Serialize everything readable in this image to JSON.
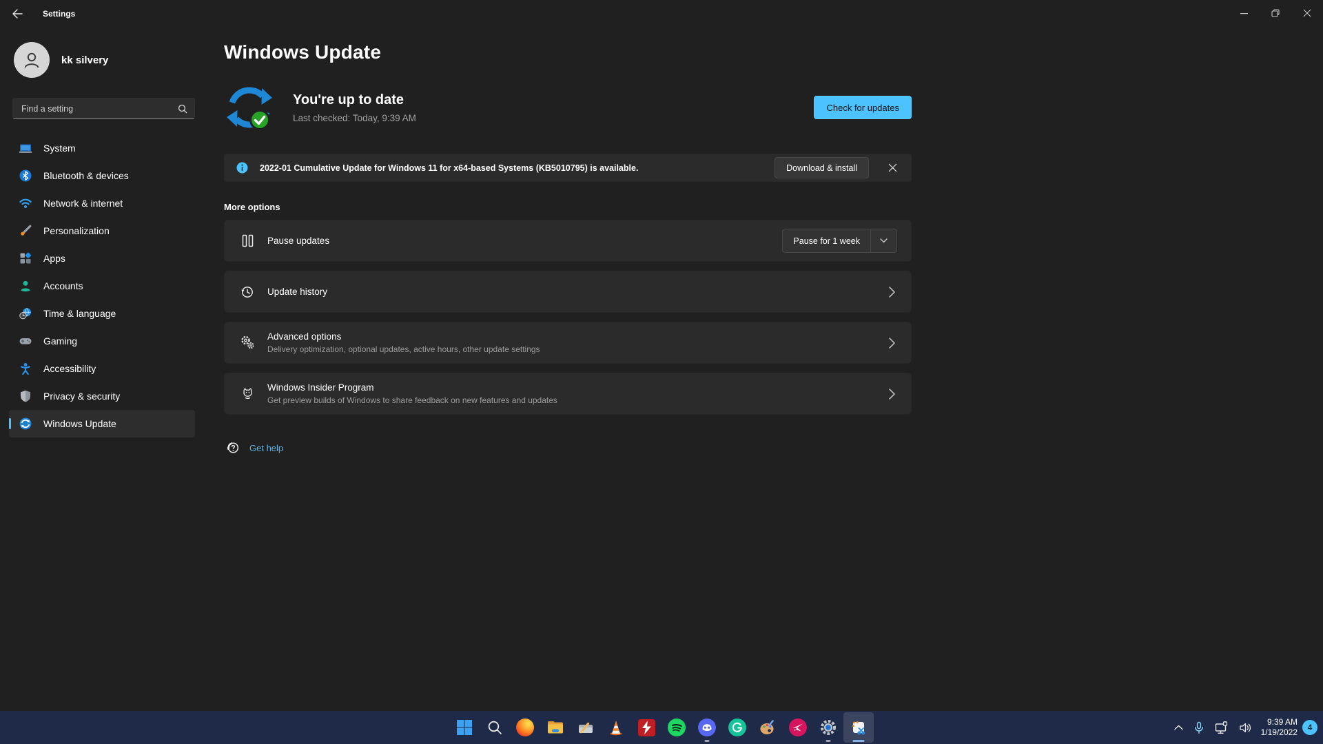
{
  "window": {
    "title": "Settings"
  },
  "sidebar": {
    "user_name": "kk silvery",
    "search_placeholder": "Find a setting",
    "items": [
      {
        "label": "System",
        "icon": "system-icon",
        "selected": false
      },
      {
        "label": "Bluetooth & devices",
        "icon": "bluetooth-icon",
        "selected": false
      },
      {
        "label": "Network & internet",
        "icon": "wifi-icon",
        "selected": false
      },
      {
        "label": "Personalization",
        "icon": "brush-icon",
        "selected": false
      },
      {
        "label": "Apps",
        "icon": "apps-icon",
        "selected": false
      },
      {
        "label": "Accounts",
        "icon": "person-icon",
        "selected": false
      },
      {
        "label": "Time & language",
        "icon": "clock-globe-icon",
        "selected": false
      },
      {
        "label": "Gaming",
        "icon": "gamepad-icon",
        "selected": false
      },
      {
        "label": "Accessibility",
        "icon": "accessibility-icon",
        "selected": false
      },
      {
        "label": "Privacy & security",
        "icon": "shield-icon",
        "selected": false
      },
      {
        "label": "Windows Update",
        "icon": "update-icon",
        "selected": true
      }
    ]
  },
  "main": {
    "title": "Windows Update",
    "hero": {
      "status_title": "You're up to date",
      "status_sub": "Last checked: Today, 9:39 AM",
      "button": "Check for updates"
    },
    "banner": {
      "text": "2022-01 Cumulative Update for Windows 11 for x64-based Systems (KB5010795) is available.",
      "button": "Download & install"
    },
    "section_label": "More options",
    "rows": [
      {
        "title": "Pause updates",
        "control": "Pause for 1 week"
      },
      {
        "title": "Update history"
      },
      {
        "title": "Advanced options",
        "subtitle": "Delivery optimization, optional updates, active hours, other update settings"
      },
      {
        "title": "Windows Insider Program",
        "subtitle": "Get preview builds of Windows to share feedback on new features and updates"
      }
    ],
    "get_help": "Get help"
  },
  "taskbar": {
    "icons": [
      "start",
      "search",
      "firefox",
      "file-explorer",
      "disk-cleanup",
      "vlc",
      "power-media-app",
      "spotify",
      "discord",
      "grammarly",
      "paint",
      "pink-media-app",
      "settings",
      "snipping-tool"
    ],
    "running_icons": [
      "discord",
      "settings"
    ],
    "active_icon": "snipping-tool",
    "tray": {
      "time": "9:39 AM",
      "date": "1/19/2022",
      "badge": "4"
    }
  },
  "colors": {
    "accent": "#4cc2ff",
    "window_bg": "#202020",
    "card_bg": "#2b2b2b",
    "taskbar_bg": "#1e2a48",
    "link": "#5fb2e4",
    "success_green": "#27a327",
    "update_blue": "#1e87d6"
  }
}
